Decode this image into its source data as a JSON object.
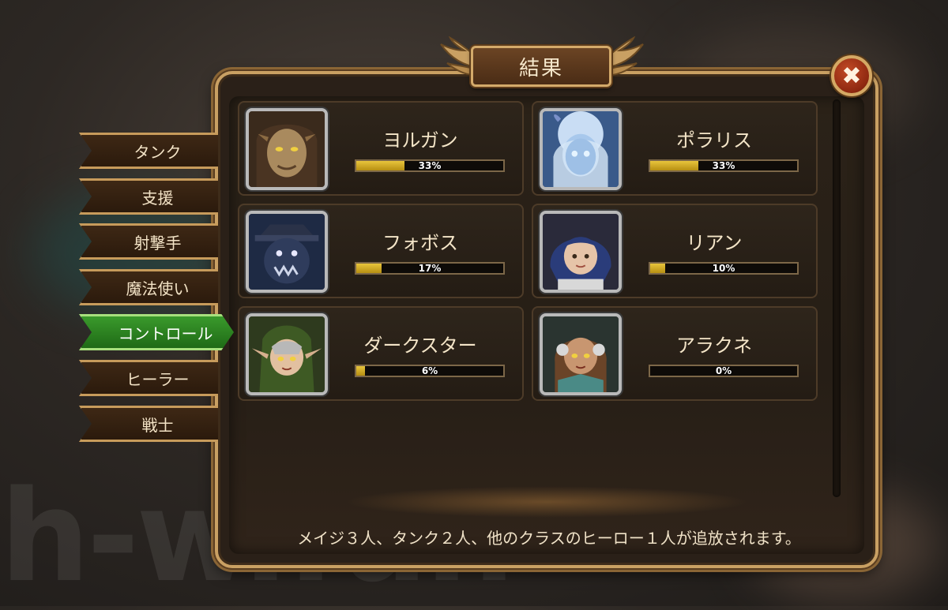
{
  "title": "結果",
  "close_label": "✖",
  "watermark": "h-w.fun",
  "tabs": [
    {
      "label": "タンク",
      "active": false
    },
    {
      "label": "支援",
      "active": false
    },
    {
      "label": "射撃手",
      "active": false
    },
    {
      "label": "魔法使い",
      "active": false
    },
    {
      "label": "コントロール",
      "active": true
    },
    {
      "label": "ヒーラー",
      "active": false
    },
    {
      "label": "戦士",
      "active": false
    }
  ],
  "heroes": [
    {
      "name": "ヨルガン",
      "percent": 33,
      "percent_label": "33%",
      "portrait_icon": "hooded-beast-portrait"
    },
    {
      "name": "ポラリス",
      "percent": 33,
      "percent_label": "33%",
      "portrait_icon": "ice-spirit-portrait"
    },
    {
      "name": "フォボス",
      "percent": 17,
      "percent_label": "17%",
      "portrait_icon": "dark-creature-portrait"
    },
    {
      "name": "リアン",
      "percent": 10,
      "percent_label": "10%",
      "portrait_icon": "blue-haired-girl-portrait"
    },
    {
      "name": "ダークスター",
      "percent": 6,
      "percent_label": "6%",
      "portrait_icon": "hooded-elf-portrait"
    },
    {
      "name": "アラクネ",
      "percent": 0,
      "percent_label": "0%",
      "portrait_icon": "armored-woman-portrait"
    }
  ],
  "footer": "メイジ３人、タンク２人、他のクラスのヒーロー１人が追放されます。",
  "colors": {
    "accent_gold": "#c9a063",
    "active_tab": "#2f8a22",
    "bar_fill": "#d4b02a",
    "close_red": "#a8361a"
  }
}
